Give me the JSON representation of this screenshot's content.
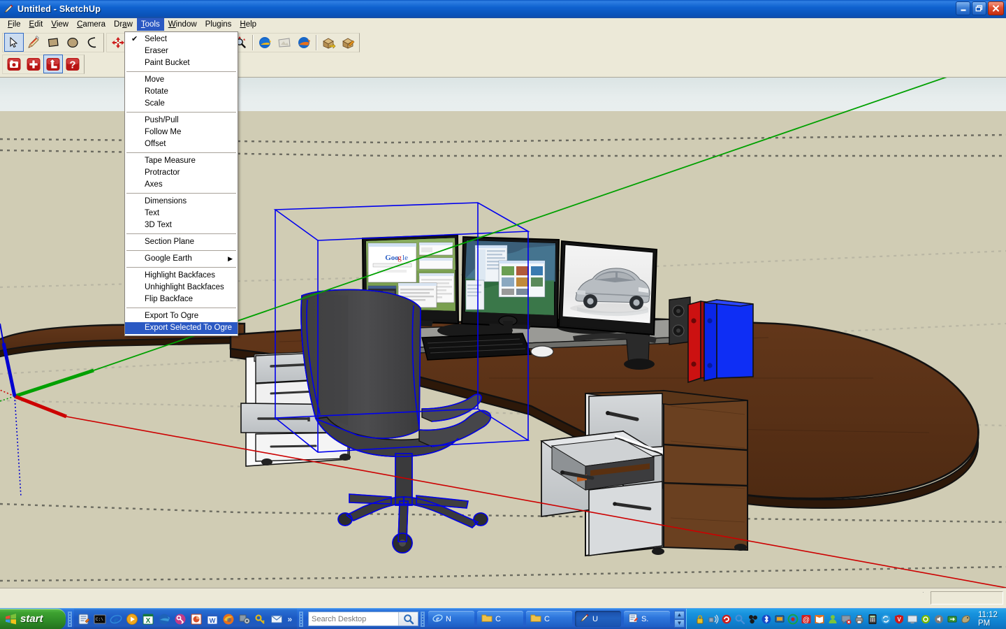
{
  "window": {
    "title": "Untitled - SketchUp",
    "app_icon": "sketchup-pencil-icon",
    "minimize_label": "_",
    "maximize_label": "❐",
    "close_label": "✕"
  },
  "menubar": {
    "items": [
      {
        "label": "File",
        "accel": "F",
        "active": false
      },
      {
        "label": "Edit",
        "accel": "E",
        "active": false
      },
      {
        "label": "View",
        "accel": "V",
        "active": false
      },
      {
        "label": "Camera",
        "accel": "C",
        "active": false
      },
      {
        "label": "Draw",
        "accel": "a",
        "active": false
      },
      {
        "label": "Tools",
        "accel": "T",
        "active": true
      },
      {
        "label": "Window",
        "accel": "W",
        "active": false
      },
      {
        "label": "Plugins",
        "accel": "",
        "active": false
      },
      {
        "label": "Help",
        "accel": "H",
        "active": false
      }
    ]
  },
  "tools_menu": {
    "title": "Tools",
    "items": [
      {
        "label": "Select",
        "checked": true
      },
      {
        "label": "Eraser",
        "checked": false
      },
      {
        "label": "Paint Bucket",
        "checked": false
      },
      {
        "separator": true
      },
      {
        "label": "Move",
        "checked": false
      },
      {
        "label": "Rotate",
        "checked": false
      },
      {
        "label": "Scale",
        "checked": false
      },
      {
        "separator": true
      },
      {
        "label": "Push/Pull",
        "checked": false
      },
      {
        "label": "Follow Me",
        "checked": false
      },
      {
        "label": "Offset",
        "checked": false
      },
      {
        "separator": true
      },
      {
        "label": "Tape Measure",
        "checked": false
      },
      {
        "label": "Protractor",
        "checked": false
      },
      {
        "label": "Axes",
        "checked": false
      },
      {
        "separator": true
      },
      {
        "label": "Dimensions",
        "checked": false
      },
      {
        "label": "Text",
        "checked": false
      },
      {
        "label": "3D Text",
        "checked": false
      },
      {
        "separator": true
      },
      {
        "label": "Section Plane",
        "checked": false
      },
      {
        "separator": true
      },
      {
        "label": "Google Earth",
        "checked": false,
        "submenu": true
      },
      {
        "separator": true
      },
      {
        "label": "Highlight Backfaces",
        "checked": false
      },
      {
        "label": "Unhighlight Backfaces",
        "checked": false
      },
      {
        "label": "Flip Backface",
        "checked": false
      },
      {
        "separator": true
      },
      {
        "label": "Export To Ogre",
        "checked": false
      },
      {
        "label": "Export Selected To Ogre",
        "checked": false,
        "selected": true
      }
    ]
  },
  "toolbars": {
    "principal": [
      {
        "name": "select-tool",
        "pressed": true
      },
      {
        "name": "line-tool",
        "pressed": false
      },
      {
        "name": "rectangle-tool",
        "pressed": false
      },
      {
        "name": "circle-tool",
        "pressed": false
      },
      {
        "name": "arc-tool",
        "pressed": false
      }
    ],
    "camera": [
      {
        "name": "orbit-tool",
        "pressed": false
      },
      {
        "name": "rotate-tool",
        "pressed": false
      },
      {
        "name": "undo-tool",
        "pressed": false
      },
      {
        "name": "orbit-red-tool",
        "pressed": false
      },
      {
        "name": "pan-tool",
        "pressed": false
      },
      {
        "name": "zoom-tool",
        "pressed": false
      },
      {
        "name": "zoom-extents-tool",
        "pressed": false
      },
      {
        "name": "google-earth-globe",
        "pressed": false
      },
      {
        "name": "google-earth-snapshot",
        "pressed": false
      },
      {
        "name": "google-earth-place-model",
        "pressed": false
      },
      {
        "name": "warehouse-get-model",
        "pressed": false
      },
      {
        "name": "warehouse-share-model",
        "pressed": false
      }
    ],
    "sandbox": [
      {
        "name": "photo-match-tool",
        "pressed": false
      },
      {
        "name": "add-tool",
        "pressed": false
      },
      {
        "name": "axes-tool",
        "pressed": true
      },
      {
        "name": "help-tool",
        "pressed": false
      }
    ]
  },
  "viewport": {
    "sky_color_top": "#dbe4e4",
    "sky_color_bottom": "#e9eeee",
    "ground_color": "#d0ccb4",
    "axis_red_color": "#cc0000",
    "axis_green_color": "#00a000",
    "axis_blue_color": "#0000d0",
    "selection_color": "#0000ee",
    "desk_wood_color": "#5e3518",
    "desk_wood_dark": "#4a2a12",
    "drawer_front_color": "#c9ccce",
    "chair_color": "#4a4a4c",
    "book_red_color": "#cc1111",
    "book_blue_color": "#0a26e8",
    "screens": [
      {
        "name": "monitor-left",
        "content": "Google search page with browser windows"
      },
      {
        "name": "monitor-center",
        "content": "Windows desktop with explorer windows"
      },
      {
        "name": "monitor-right",
        "content": "Silver sedan car photo"
      }
    ],
    "selected_object": "office-chair"
  },
  "statusbar": {
    "vcb_value": "",
    "hint": ""
  },
  "taskbar": {
    "start_label": "start",
    "quicklaunch": [
      {
        "name": "notes-icon",
        "glyph": "✎",
        "color": "#2f6fd0"
      },
      {
        "name": "command-prompt-icon",
        "glyph": "■",
        "color": "#111111"
      },
      {
        "name": "internet-explorer-icon",
        "glyph": "e",
        "color": "#1a73c8"
      },
      {
        "name": "media-player-icon",
        "glyph": "▶",
        "color": "#e08a1e"
      },
      {
        "name": "excel-icon",
        "glyph": "X",
        "color": "#137a3c"
      },
      {
        "name": "google-earth-icon",
        "glyph": "●",
        "color": "#1d4f8f"
      },
      {
        "name": "keepass-icon",
        "glyph": "⚿",
        "color": "#b8337a"
      },
      {
        "name": "powerpoint-icon",
        "glyph": "P",
        "color": "#d04423"
      },
      {
        "name": "word-icon",
        "glyph": "W",
        "color": "#1f5fc0"
      },
      {
        "name": "firefox-icon",
        "glyph": "◐",
        "color": "#e8701a"
      },
      {
        "name": "settings-icon",
        "glyph": "⚙",
        "color": "#6a6a6a"
      },
      {
        "name": "key-icon",
        "glyph": "⚷",
        "color": "#e0c020"
      },
      {
        "name": "mail-icon",
        "glyph": "✉",
        "color": "#2f7fd8"
      }
    ],
    "quicklaunch_more": "»",
    "search": {
      "placeholder": "Search Desktop",
      "value": "",
      "button_icon": "search-icon"
    },
    "windows": [
      {
        "name": "taskbar-item-ie",
        "icon": "internet-explorer-icon",
        "label": "N",
        "active": false
      },
      {
        "name": "taskbar-item-folder-1",
        "icon": "folder-icon",
        "label": "C",
        "active": false
      },
      {
        "name": "taskbar-item-folder-2",
        "icon": "folder-icon",
        "label": "C",
        "active": false
      },
      {
        "name": "taskbar-item-sketchup",
        "icon": "sketchup-pencil-icon",
        "label": "U",
        "active": true
      },
      {
        "name": "taskbar-item-editor",
        "icon": "editor-icon",
        "label": "S.",
        "active": false
      }
    ],
    "scroll_up": "▲",
    "scroll_down": "▼",
    "tray": [
      {
        "name": "lock-icon",
        "glyph": "⚿",
        "color": "#e8c22a"
      },
      {
        "name": "wireless-icon",
        "glyph": "⌇",
        "color": "#9aa8b8"
      },
      {
        "name": "antivirus-icon",
        "glyph": "↻",
        "color": "#cc2020"
      },
      {
        "name": "search-indexer-icon",
        "glyph": "⚲",
        "color": "#5a9ad8"
      },
      {
        "name": "dropbox-icon",
        "glyph": "❖",
        "color": "#1b1b1b"
      },
      {
        "name": "bluetooth-icon",
        "glyph": "ʙ",
        "color": "#1549c8"
      },
      {
        "name": "remote-desktop-icon",
        "glyph": "▣",
        "color": "#e8a020"
      },
      {
        "name": "record-icon",
        "glyph": "◎",
        "color": "#16a04a"
      },
      {
        "name": "share-icon",
        "glyph": "@",
        "color": "#d02020"
      },
      {
        "name": "books-icon",
        "glyph": "◧",
        "color": "#e8701a"
      },
      {
        "name": "user-icon",
        "glyph": "♟",
        "color": "#7cc43a"
      },
      {
        "name": "messenger-icon",
        "glyph": "✉",
        "color": "#7a8a9a"
      },
      {
        "name": "printer-icon",
        "glyph": "⎙",
        "color": "#888888"
      },
      {
        "name": "calculator-icon",
        "glyph": "⌸",
        "color": "#333333"
      },
      {
        "name": "sync-icon",
        "glyph": "⇄",
        "color": "#3aa0dd"
      },
      {
        "name": "security-shield-icon",
        "glyph": "⛨",
        "color": "#cc1a1a"
      },
      {
        "name": "display-icon",
        "glyph": "▭",
        "color": "#dddddd"
      },
      {
        "name": "nvidia-icon",
        "glyph": "◉",
        "color": "#76b900"
      },
      {
        "name": "volume-icon",
        "glyph": "♫",
        "color": "#7a7a7a"
      },
      {
        "name": "network-icon",
        "glyph": "⇅",
        "color": "#3a9a3a"
      },
      {
        "name": "mouse-icon",
        "glyph": "⌕",
        "color": "#b8a878"
      }
    ],
    "clock": "11:12 PM"
  }
}
